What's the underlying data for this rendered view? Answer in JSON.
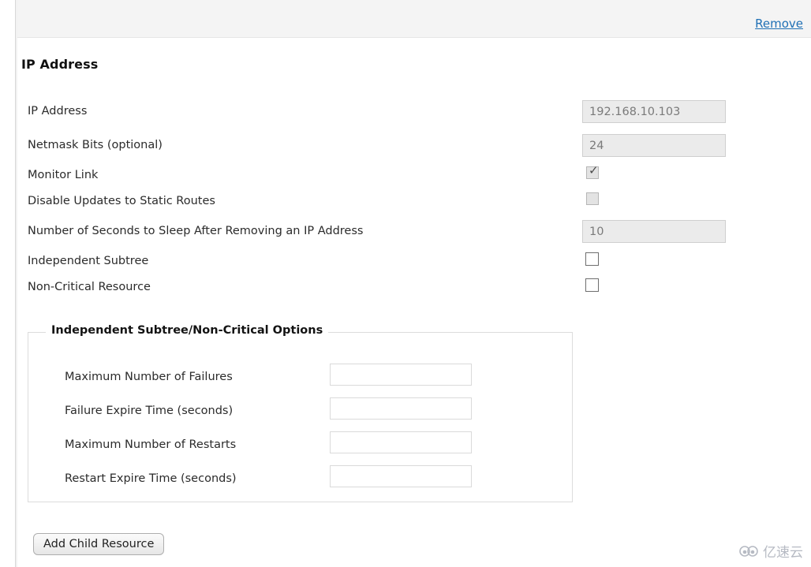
{
  "header": {
    "remove_label": "Remove"
  },
  "section": {
    "title": "IP Address"
  },
  "fields": [
    {
      "label": "IP Address",
      "type": "text",
      "value": "192.168.10.103",
      "disabled": true
    },
    {
      "label": "Netmask Bits (optional)",
      "type": "text",
      "value": "24",
      "disabled": true
    },
    {
      "label": "Monitor Link",
      "type": "checkbox",
      "checked": true,
      "disabled": true
    },
    {
      "label": "Disable Updates to Static Routes",
      "type": "checkbox",
      "checked": false,
      "disabled": true
    },
    {
      "label": "Number of Seconds to Sleep After Removing an IP Address",
      "type": "text",
      "value": "10",
      "disabled": true
    },
    {
      "label": "Independent Subtree",
      "type": "checkbox",
      "checked": false,
      "disabled": false
    },
    {
      "label": "Non-Critical Resource",
      "type": "checkbox",
      "checked": false,
      "disabled": false
    }
  ],
  "fieldset": {
    "legend": "Independent Subtree/Non-Critical Options",
    "rows": [
      {
        "label": "Maximum Number of Failures",
        "value": ""
      },
      {
        "label": "Failure Expire Time (seconds)",
        "value": ""
      },
      {
        "label": "Maximum Number of Restarts",
        "value": ""
      },
      {
        "label": "Restart Expire Time (seconds)",
        "value": ""
      }
    ]
  },
  "actions": {
    "add_child_resource": "Add Child Resource"
  },
  "watermark": {
    "text": "亿速云",
    "icon": "cloud-icon"
  },
  "colors": {
    "link": "#1f70b5",
    "header_band": "#f4f4f4",
    "disabled_field_bg": "#ebebeb",
    "panel_bg": "#ffffff"
  }
}
